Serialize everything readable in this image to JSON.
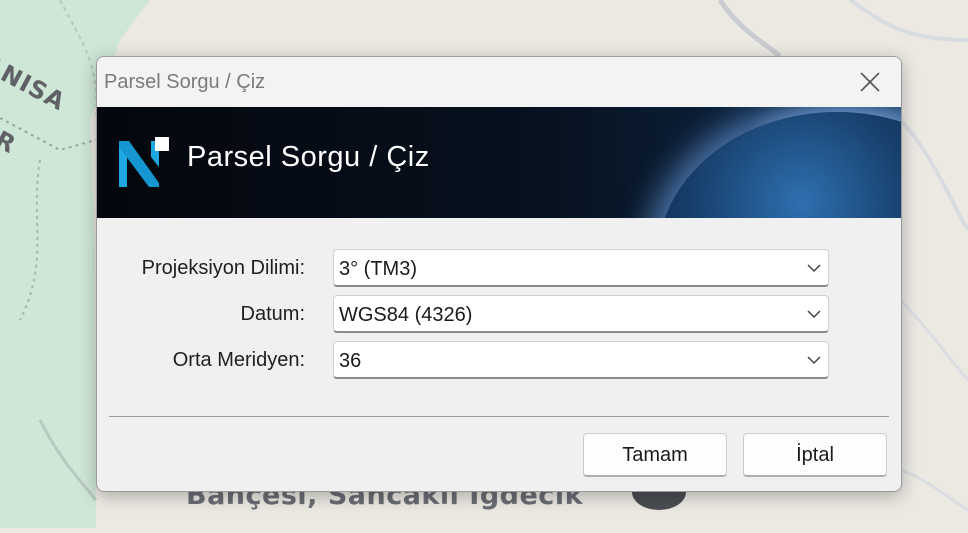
{
  "map": {
    "region_label": "ANISA",
    "region_label_2": "R",
    "place_label": "Bahçesi, Sancaklı Iğdecik"
  },
  "dialog": {
    "window_title": "Parsel Sorgu / Çiz",
    "banner_title": "Parsel Sorgu / Çiz",
    "fields": [
      {
        "label": "Projeksiyon Dilimi:",
        "value": "3° (TM3)"
      },
      {
        "label": "Datum:",
        "value": "WGS84 (4326)"
      },
      {
        "label": "Orta Meridyen:",
        "value": "36"
      }
    ],
    "ok_label": "Tamam",
    "cancel_label": "İptal"
  },
  "icons": {
    "close": "close-icon",
    "logo": "app-logo-icon",
    "dropdown": "chevron-down-icon"
  },
  "colors": {
    "map_green": "#cfe7d7",
    "banner_dark": "#04070d",
    "logo_cyan": "#1ea7e1"
  }
}
